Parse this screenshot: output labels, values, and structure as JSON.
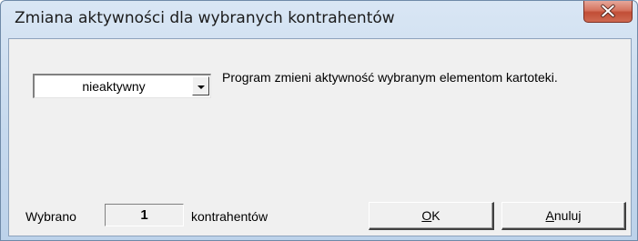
{
  "window": {
    "title": "Zmiana aktywności dla wybranych kontrahentów",
    "close_icon": "close-icon"
  },
  "activity_select": {
    "selected": "nieaktywny",
    "arrow_icon": "chevron-down-icon"
  },
  "description": "Program zmieni aktywność wybranym elementom kartoteki.",
  "selection": {
    "prefix": "Wybrano",
    "count": "1",
    "suffix": "kontrahentów"
  },
  "buttons": {
    "ok": {
      "accel": "O",
      "rest": "K"
    },
    "cancel": {
      "accel": "A",
      "rest": "nuluj"
    }
  },
  "colors": {
    "close_button": "#c9573f",
    "dialog_background": "#f0f0f0",
    "title_bar": "#c6d9ee"
  }
}
